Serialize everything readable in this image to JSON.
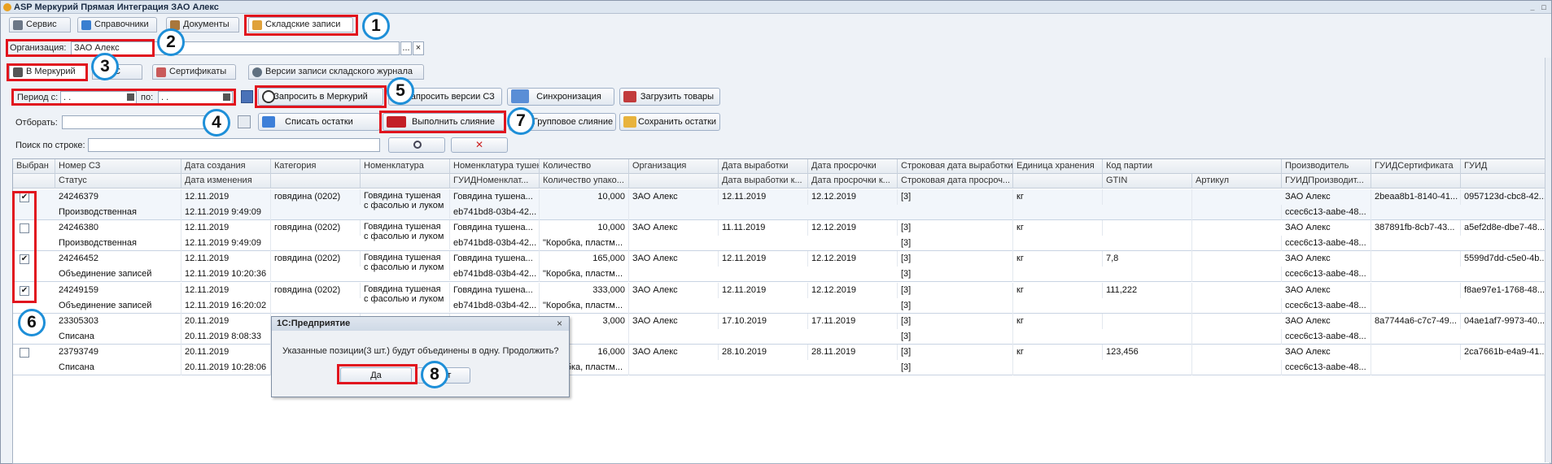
{
  "app": {
    "title": "ASP Меркурий Прямая Интеграция ЗАО Алекс",
    "window_controls": [
      "_",
      "□"
    ]
  },
  "main_tabs": [
    "Сервис",
    "Справочники",
    "Документы",
    "Складские записи"
  ],
  "org": {
    "label": "Организация:",
    "value": "ЗАО Алекс",
    "select_btn": "...",
    "clear_btn": "×"
  },
  "sub_tabs": [
    "В Меркурий",
    "1С",
    "Сертификаты",
    "Версии записи складского журнала"
  ],
  "filters": {
    "period_label": "Период с:",
    "period_from": " .  .",
    "period_to_label": "по:",
    "period_to": " .  .",
    "select_label": "Отборать:",
    "search_label": "Поиск по строке:"
  },
  "buttons": {
    "request_mercury": "Запросить в Меркурий",
    "request_versions": "Запросить версии СЗ",
    "sync": "Синхронизация",
    "load_goods": "Загрузить товары",
    "writeoff": "Списать остатки",
    "merge": "Выполнить слияние",
    "group_merge": "Групповое слияние",
    "save_remains": "Сохранить остатки"
  },
  "callouts": [
    "1",
    "2",
    "3",
    "4",
    "5",
    "6",
    "7",
    "8"
  ],
  "columns_top": [
    "Выбран",
    "Номер СЗ",
    "Дата создания",
    "Категория",
    "Номенклатура",
    "Номенклатура тушенка",
    "Количество",
    "Организация",
    "Дата выработки",
    "Дата просрочки",
    "Строковая дата выработки",
    "Единица хранения",
    "Код партии",
    "Производитель",
    "ГУИДСертификата",
    "ГУИД"
  ],
  "columns_bottom": [
    "",
    "Статус",
    "Дата изменения",
    "",
    "",
    "ГУИДНоменклат...",
    "Количество упако...",
    "",
    "Дата выработки к...",
    "Дата просрочки к...",
    "Строковая дата просроч...",
    "",
    "GTIN",
    "Артикул",
    "ГУИДПроизводит...",
    "",
    ""
  ],
  "rows": [
    {
      "checked": "✔",
      "num": "24246379",
      "status": "Производственная",
      "created": "12.11.2019",
      "changed": "12.11.2019 9:49:09",
      "category": "говядина (0202)",
      "nom": "Говядина тушеная с фасолью и луком",
      "nom2": "Говядина тушена...",
      "guid_nom": "eb741bd8-03b4-42...",
      "qty": "10,000",
      "pack": "",
      "org": "ЗАО Алекс",
      "prod": "12.11.2019",
      "exp": "12.12.2019",
      "sdate": "[3]",
      "sexp": "",
      "unit": "кг",
      "batch": "",
      "gtin": "",
      "art": "",
      "maker": "ЗАО Алекс",
      "maker_guid": "ccec6c13-aabe-48...",
      "cert": "2beaa8b1-8140-41...",
      "guid": "0957123d-cbc8-42..."
    },
    {
      "checked": "",
      "num": "24246380",
      "status": "Производственная",
      "created": "12.11.2019",
      "changed": "12.11.2019 9:49:09",
      "category": "говядина (0202)",
      "nom": "Говядина тушеная с фасолью и луком",
      "nom2": "Говядина тушена...",
      "guid_nom": "eb741bd8-03b4-42...",
      "qty": "10,000",
      "pack": "\"Коробка, пластм...",
      "org": "ЗАО Алекс",
      "prod": "11.11.2019",
      "exp": "12.12.2019",
      "sdate": "[3]",
      "sexp": "[3]",
      "unit": "кг",
      "batch": "",
      "gtin": "",
      "art": "",
      "maker": "ЗАО Алекс",
      "maker_guid": "ccec6c13-aabe-48...",
      "cert": "387891fb-8cb7-43...",
      "guid": "a5ef2d8e-dbe7-48..."
    },
    {
      "checked": "✔",
      "num": "24246452",
      "status": "Объединение записей",
      "created": "12.11.2019",
      "changed": "12.11.2019 10:20:36",
      "category": "говядина (0202)",
      "nom": "Говядина тушеная с фасолью и луком",
      "nom2": "Говядина тушена...",
      "guid_nom": "eb741bd8-03b4-42...",
      "qty": "165,000",
      "pack": "\"Коробка, пластм...",
      "org": "ЗАО Алекс",
      "prod": "12.11.2019",
      "exp": "12.12.2019",
      "sdate": "[3]",
      "sexp": "[3]",
      "unit": "кг",
      "batch": "7,8",
      "gtin": "",
      "art": "",
      "maker": "ЗАО Алекс",
      "maker_guid": "ccec6c13-aabe-48...",
      "cert": "",
      "guid": "5599d7dd-c5e0-4b..."
    },
    {
      "checked": "✔",
      "num": "24249159",
      "status": "Объединение записей",
      "created": "12.11.2019",
      "changed": "12.11.2019 16:20:02",
      "category": "говядина (0202)",
      "nom": "Говядина тушеная с фасолью и луком",
      "nom2": "Говядина тушена...",
      "guid_nom": "eb741bd8-03b4-42...",
      "qty": "333,000",
      "pack": "\"Коробка, пластм...",
      "org": "ЗАО Алекс",
      "prod": "12.11.2019",
      "exp": "12.12.2019",
      "sdate": "[3]",
      "sexp": "[3]",
      "unit": "кг",
      "batch": "111,222",
      "gtin": "",
      "art": "",
      "maker": "ЗАО Алекс",
      "maker_guid": "ccec6c13-aabe-48...",
      "cert": "",
      "guid": "f8ae97e1-1768-48..."
    },
    {
      "checked": "",
      "num": "23305303",
      "status": "Списана",
      "created": "20.11.2019",
      "changed": "20.11.2019 8:08:33",
      "category": "",
      "nom": "",
      "nom2": "",
      "guid_nom": "",
      "qty": "3,000",
      "pack": "",
      "org": "ЗАО Алекс",
      "prod": "17.10.2019",
      "exp": "17.11.2019",
      "sdate": "[3]",
      "sexp": "[3]",
      "unit": "кг",
      "batch": "",
      "gtin": "",
      "art": "",
      "maker": "ЗАО Алекс",
      "maker_guid": "ccec6c13-aabe-48...",
      "cert": "8a7744a6-c7c7-49...",
      "guid": "04ae1af7-9973-40..."
    },
    {
      "checked": "",
      "num": "23793749",
      "status": "Списана",
      "created": "20.11.2019",
      "changed": "20.11.2019 10:28:06",
      "category": "",
      "nom": "",
      "nom2": "",
      "guid_nom": "",
      "qty": "16,000",
      "pack": "\"Коробка, пластм...",
      "org": "ЗАО Алекс",
      "prod": "28.10.2019",
      "exp": "28.11.2019",
      "sdate": "[3]",
      "sexp": "[3]",
      "unit": "кг",
      "batch": "123,456",
      "gtin": "",
      "art": "",
      "maker": "ЗАО Алекс",
      "maker_guid": "ccec6c13-aabe-48...",
      "cert": "",
      "guid": "2ca7661b-e4a9-41..."
    }
  ],
  "dialog": {
    "title": "1С:Предприятие",
    "message": "Указанные позиции(3 шт.) будут объединены в одну. Продолжить?",
    "yes": "Да",
    "no": "Нет",
    "close": "×"
  },
  "colors": {
    "callout_red": "#e1141e",
    "callout_blue": "#1e8fd8"
  }
}
